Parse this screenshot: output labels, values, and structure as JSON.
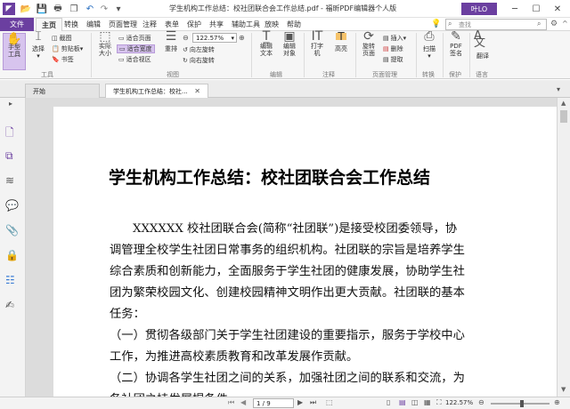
{
  "titlebar": {
    "title": "学生机构工作总结：校社团联合会工作总结.pdf - 福昕PDF编辑器个人版",
    "login": "叶LO"
  },
  "menu": {
    "file": "文件",
    "tabs": [
      "主页",
      "转换",
      "编辑",
      "页面管理",
      "注释",
      "表单",
      "保护",
      "共享",
      "辅助工具",
      "放映",
      "帮助"
    ],
    "search_placeholder": "查找"
  },
  "ribbon": {
    "hand": "手型工具",
    "select": "选择",
    "screenshot": "截图",
    "clipboard": "剪贴板",
    "bookmark": "书签",
    "group_tools": "工具",
    "actual_size": "实际大小",
    "fit_page": "适合页面",
    "fit_width": "适合宽度",
    "fit_visible": "适合视区",
    "reflow": "重排",
    "zoom_value": "122.57%",
    "rotate_left": "向左旋转",
    "rotate_right": "向右旋转",
    "group_view": "视图",
    "edit_text": "编辑文本",
    "edit_object": "编辑对象",
    "group_edit": "编辑",
    "typewriter": "打字机",
    "highlight": "高亮",
    "group_comment": "注释",
    "rotate_page": "旋转页面",
    "insert": "插入",
    "delete": "删除",
    "extract": "提取",
    "group_pages": "页面管理",
    "scan": "扫描",
    "group_convert": "转换",
    "pdf_sign": "PDF签名",
    "group_protect": "保护",
    "translate": "翻译",
    "group_lang": "语言"
  },
  "doctabs": [
    "开始",
    "学生机构工作总结：校社..."
  ],
  "document": {
    "title": "学生机构工作总结：校社团联合会工作总结",
    "lines": [
      "XXXXXX 校社团联合会(简称“社团联”)是接受校团委领导，协",
      "调管理全校学生社团日常事务的组织机构。社团联的宗旨是培养学生",
      "综合素质和创新能力，全面服务于学生社团的健康发展，协助学生社",
      "团为繁荣校园文化、创建校园精神文明作出更大贡献。社团联的基本",
      "任务：",
      "（一）贯彻各级部门关于学生社团建设的重要指示，服务于学校中心",
      "工作，为推进高校素质教育和改革发展作贡献。",
      "（二）协调各学生社团之间的关系，加强社团之间的联系和交流，为",
      "各社团之持发展提条件"
    ]
  },
  "status": {
    "page": "1 / 9",
    "zoom": "122.57%"
  }
}
